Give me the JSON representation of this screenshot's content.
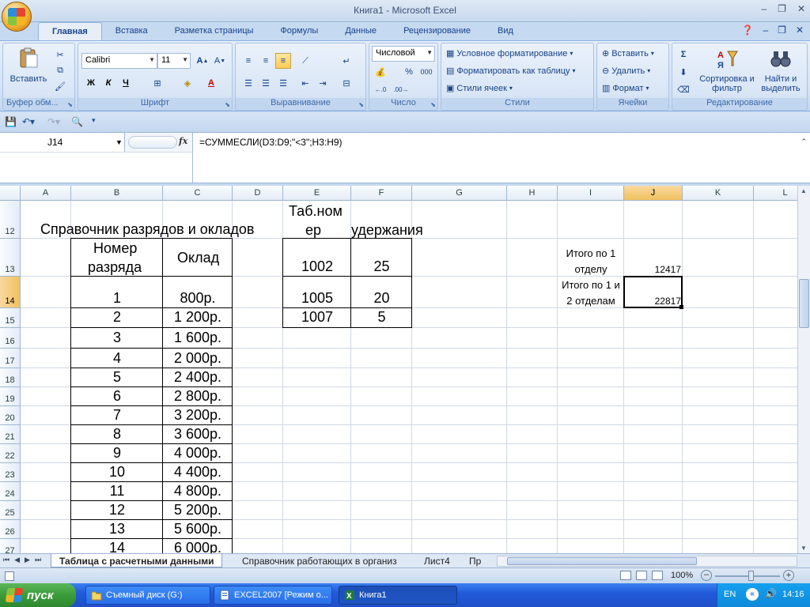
{
  "window": {
    "title": "Книга1 - Microsoft Excel",
    "controls": [
      "–",
      "❐",
      "✕"
    ]
  },
  "ribbon": {
    "tabs": [
      "Главная",
      "Вставка",
      "Разметка страницы",
      "Формулы",
      "Данные",
      "Рецензирование",
      "Вид"
    ],
    "active_tab": "Главная",
    "clipboard": {
      "label": "Буфер обм...",
      "paste": "Вставить"
    },
    "font": {
      "label": "Шрифт",
      "name": "Calibri",
      "size": "11",
      "bold": "Ж",
      "italic": "К",
      "underline": "Ч"
    },
    "alignment": {
      "label": "Выравнивание"
    },
    "number": {
      "label": "Число",
      "format": "Числовой",
      "percent": "%",
      "thousands": "000"
    },
    "styles": {
      "label": "Стили",
      "conditional": "Условное форматирование",
      "as_table": "Форматировать как таблицу",
      "cell_styles": "Стили ячеек"
    },
    "cells": {
      "label": "Ячейки",
      "insert": "Вставить",
      "delete": "Удалить",
      "format": "Формат"
    },
    "editing": {
      "label": "Редактирование",
      "sort": "Сортировка и фильтр",
      "find": "Найти и выделить"
    }
  },
  "formula_bar": {
    "cell_ref": "J14",
    "fx": "fx",
    "formula": "=СУММЕСЛИ(D3:D9;\"<3\";H3:H9)"
  },
  "grid": {
    "columns": [
      "A",
      "B",
      "C",
      "D",
      "E",
      "F",
      "G",
      "H",
      "I",
      "J",
      "K",
      "L"
    ],
    "selected_column": "J",
    "rows": [
      "12",
      "13",
      "14",
      "15",
      "16",
      "17",
      "18",
      "19",
      "20",
      "21",
      "22",
      "23",
      "24",
      "25",
      "26",
      "27"
    ],
    "selected_row": "14",
    "title_cell": "Справочник разрядов и окладов",
    "tab_header_line1": "Таб.ном",
    "tab_header_line2": "ер",
    "deductions_header": "удержания",
    "rank_header_line1": "Номер",
    "rank_header_line2": "разряда",
    "salary_header": "Оклад",
    "ranks": [
      {
        "rank": "1",
        "salary": "800р."
      },
      {
        "rank": "2",
        "salary": "1 200р."
      },
      {
        "rank": "3",
        "salary": "1 600р."
      },
      {
        "rank": "4",
        "salary": "2 000р."
      },
      {
        "rank": "5",
        "salary": "2 400р."
      },
      {
        "rank": "6",
        "salary": "2 800р."
      },
      {
        "rank": "7",
        "salary": "3 200р."
      },
      {
        "rank": "8",
        "salary": "3 600р."
      },
      {
        "rank": "9",
        "salary": "4 000р."
      },
      {
        "rank": "10",
        "salary": "4 400р."
      },
      {
        "rank": "11",
        "salary": "4 800р."
      },
      {
        "rank": "12",
        "salary": "5 200р."
      },
      {
        "rank": "13",
        "salary": "5 600р."
      },
      {
        "rank": "14",
        "salary": "6 000р."
      }
    ],
    "deductions": [
      {
        "tab": "1002",
        "amount": "25"
      },
      {
        "tab": "1005",
        "amount": "20"
      },
      {
        "tab": "1007",
        "amount": "5"
      }
    ],
    "total1_line1": "Итого по 1",
    "total1_line2": "отделу",
    "total1_value": "12417",
    "total2_line1": "Итого по 1 и",
    "total2_line2": "2 отделам",
    "total2_value": "22817"
  },
  "sheets": {
    "tabs": [
      "Таблица с расчетными данными",
      "Справочник работающих в организ",
      "Лист4",
      "Пр"
    ],
    "active": "Таблица с расчетными данными"
  },
  "status": {
    "zoom": "100%"
  },
  "taskbar": {
    "start": "пуск",
    "tasks": [
      "Съемный диск (G:)",
      "EXCEL2007 [Режим о...",
      "Книга1"
    ],
    "lang": "EN",
    "time": "14:16"
  }
}
